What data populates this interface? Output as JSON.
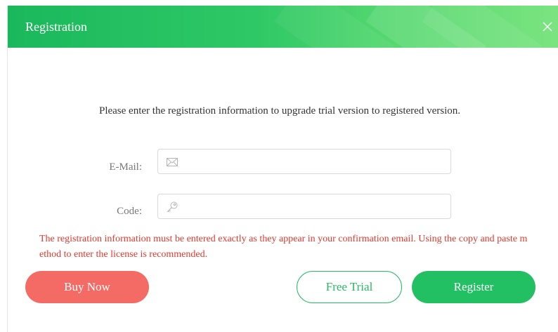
{
  "window": {
    "title": "Registration"
  },
  "intro_text": "Please enter the registration information to upgrade trial version to registered version.",
  "form": {
    "email": {
      "label": "E-Mail:",
      "value": "",
      "placeholder": ""
    },
    "code": {
      "label": "Code:",
      "value": "",
      "placeholder": ""
    }
  },
  "notice": "The registration information must be entered exactly as they appear in your confirmation email. Using the copy and paste method to enter the license is recommended.",
  "buttons": {
    "buy_now": "Buy Now",
    "free_trial": "Free Trial",
    "register": "Register"
  },
  "icons": {
    "close": "close-icon",
    "email": "mail-icon",
    "code": "key-icon"
  },
  "colors": {
    "header_start": "#1ab85c",
    "header_end": "#7be480",
    "accent_green": "#22bf63",
    "buy_red": "#f46b66",
    "notice_red": "#e03a2e"
  }
}
